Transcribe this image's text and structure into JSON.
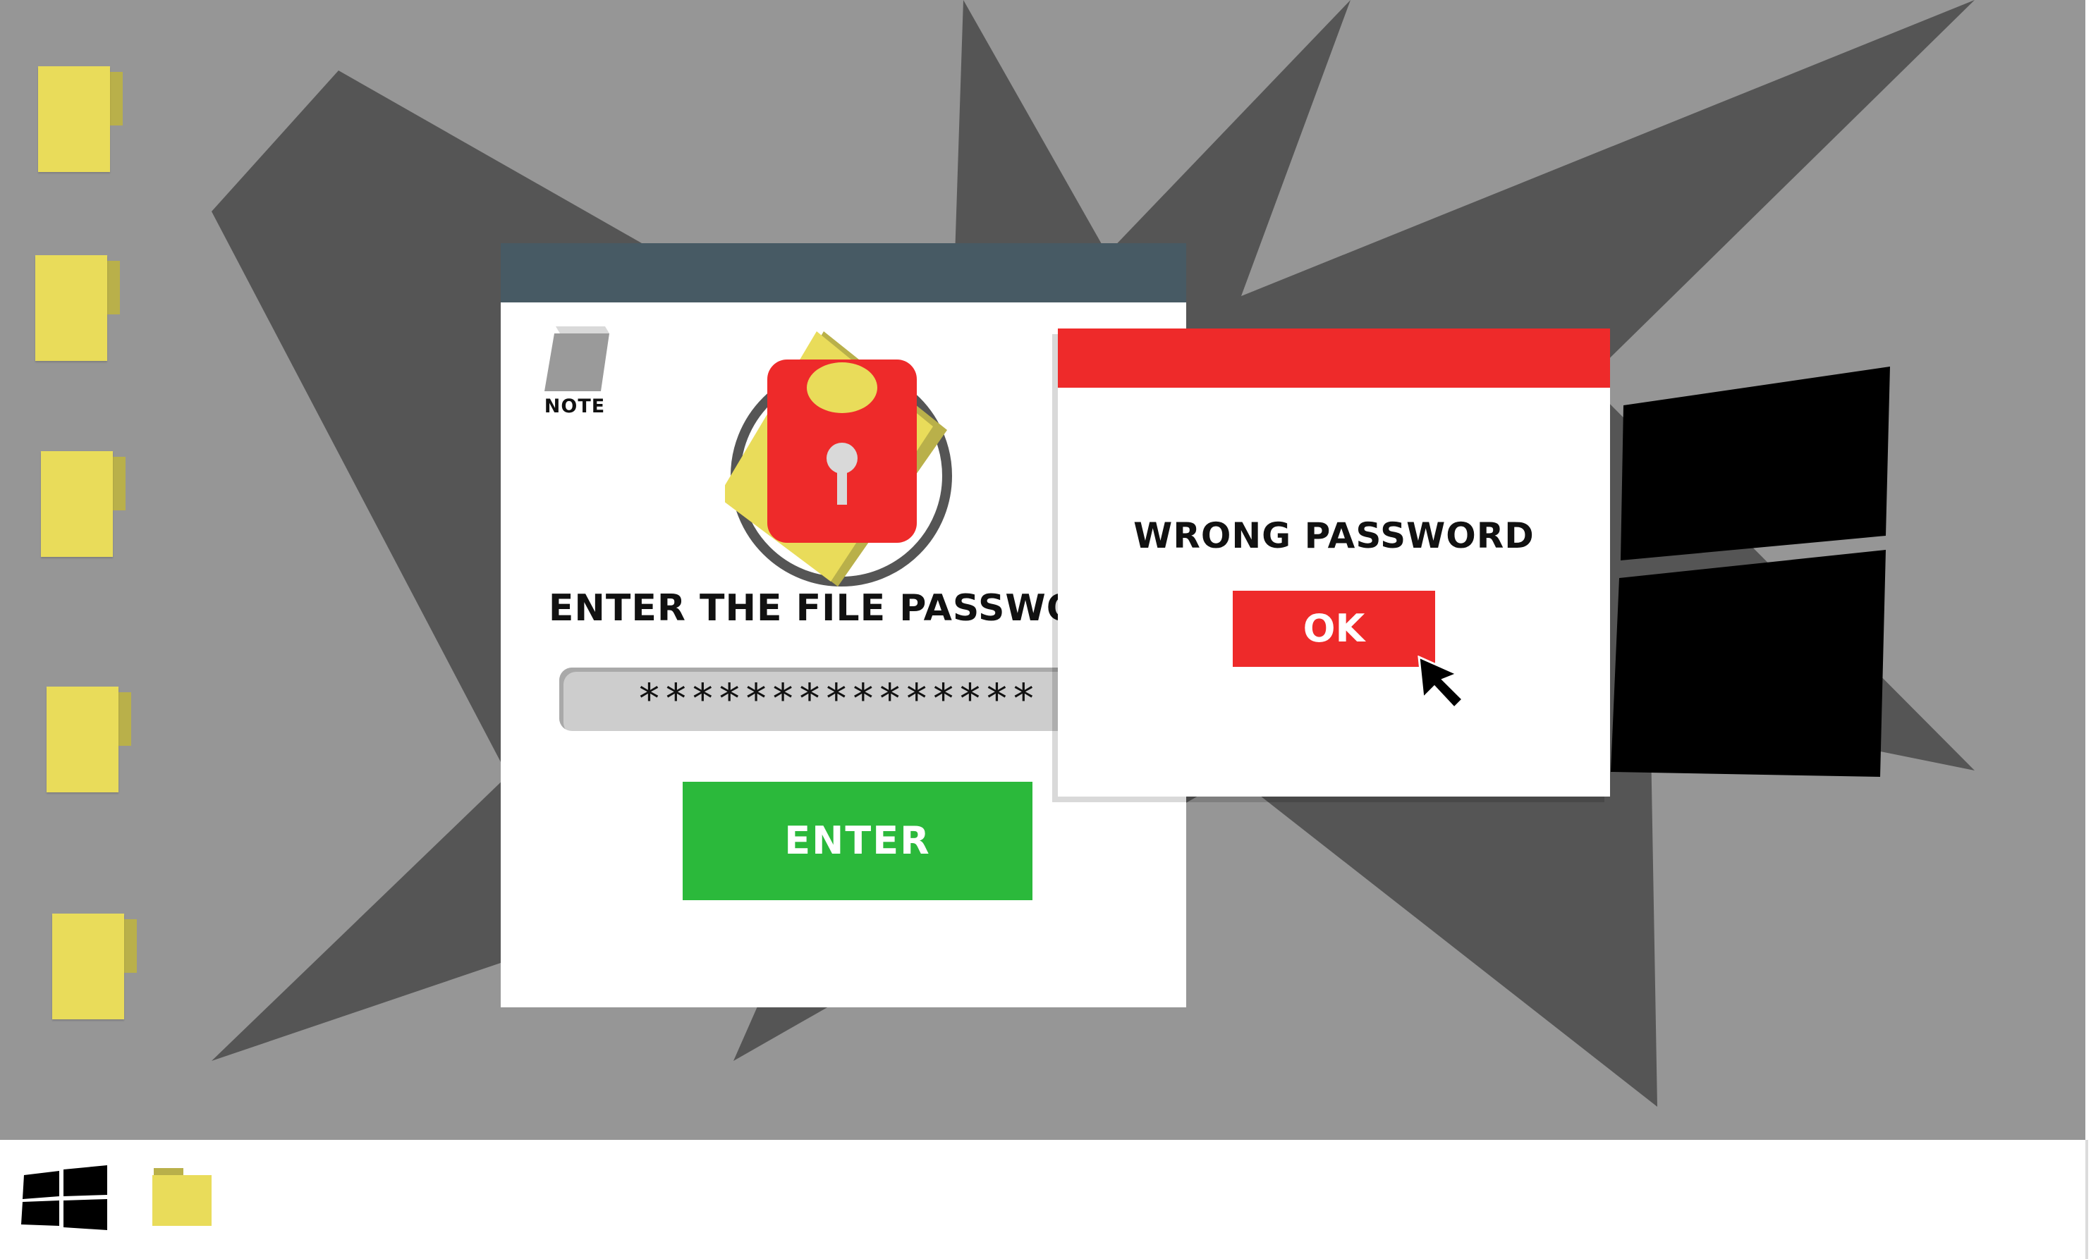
{
  "desktop": {
    "background_color": "#969696",
    "burst_color": "#555555",
    "icons": [
      {
        "icon": "sticky-note-icon"
      },
      {
        "icon": "sticky-note-icon"
      },
      {
        "icon": "sticky-note-icon"
      },
      {
        "icon": "sticky-note-icon"
      },
      {
        "icon": "sticky-note-icon"
      }
    ],
    "logo_icon": "windows-logo-icon"
  },
  "password_window": {
    "titlebar_color": "#475a64",
    "note_label": "NOTE",
    "note_icon": "note-icon",
    "emblem_icon": "padlock-icon",
    "prompt": "ENTER THE FILE PASSWORD",
    "password_value": "***************",
    "enter_label": "ENTER",
    "enter_color": "#2bb93b"
  },
  "error_dialog": {
    "titlebar_color": "#ee2a2a",
    "message": "WRONG PASSWORD",
    "ok_label": "OK"
  },
  "cursor": {
    "icon": "mouse-pointer-icon"
  },
  "taskbar": {
    "start_icon": "windows-start-icon",
    "folder_icon": "folder-icon"
  }
}
